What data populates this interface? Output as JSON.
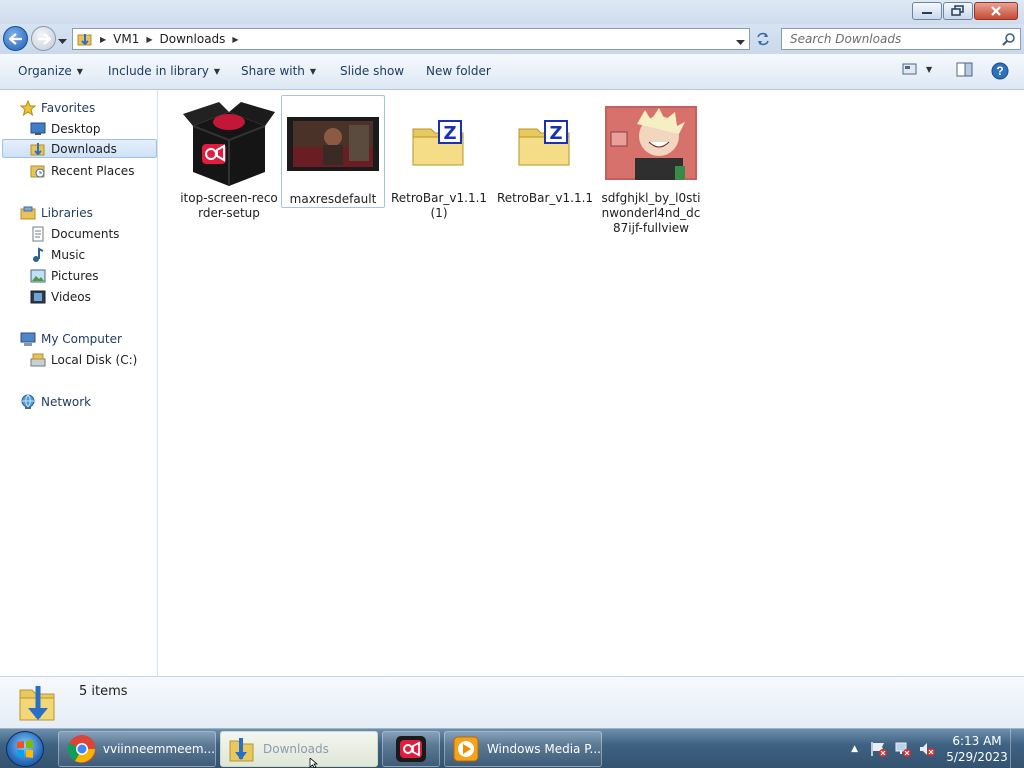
{
  "window": {
    "controls": {
      "minimize": "minimize",
      "restore": "restore",
      "close": "close"
    }
  },
  "address": {
    "crumbs": [
      "VM1",
      "Downloads"
    ],
    "search_placeholder": "Search Downloads"
  },
  "toolbar": {
    "organize": "Organize",
    "include_in_library": "Include in library",
    "share_with": "Share with",
    "slide_show": "Slide show",
    "new_folder": "New folder"
  },
  "nav": {
    "favorites": "Favorites",
    "desktop": "Desktop",
    "downloads": "Downloads",
    "recent_places": "Recent Places",
    "libraries": "Libraries",
    "documents": "Documents",
    "music": "Music",
    "pictures": "Pictures",
    "videos": "Videos",
    "my_computer": "My Computer",
    "local_disk": "Local Disk (C:)",
    "network": "Network"
  },
  "files": [
    {
      "name": "itop-screen-recorder-setup",
      "icon": "installer-box-icon"
    },
    {
      "name": "maxresdefault",
      "icon": "image-thumbnail"
    },
    {
      "name": "RetroBar_v1.1.1 (1)",
      "icon": "zip-folder-icon"
    },
    {
      "name": "RetroBar_v1.1.1",
      "icon": "zip-folder-icon"
    },
    {
      "name": "sdfghjkl_by_l0stinwonderl4nd_dc87ijf-fullview",
      "icon": "image-thumbnail"
    }
  ],
  "status": {
    "item_count": "5 items"
  },
  "taskbar": {
    "tasks": [
      {
        "label": "vviinneemmeem...",
        "icon": "chrome-icon"
      },
      {
        "label": "Downloads",
        "icon": "folder-icon"
      },
      {
        "label": "",
        "icon": "screen-recorder-icon"
      },
      {
        "label": "Windows Media P...",
        "icon": "media-player-icon"
      }
    ],
    "time": "6:13 AM",
    "date": "5/29/2023"
  },
  "colors": {
    "accent": "#1d5fb4",
    "taskbar": "#3f6283",
    "selection": "#cfe2f8"
  }
}
